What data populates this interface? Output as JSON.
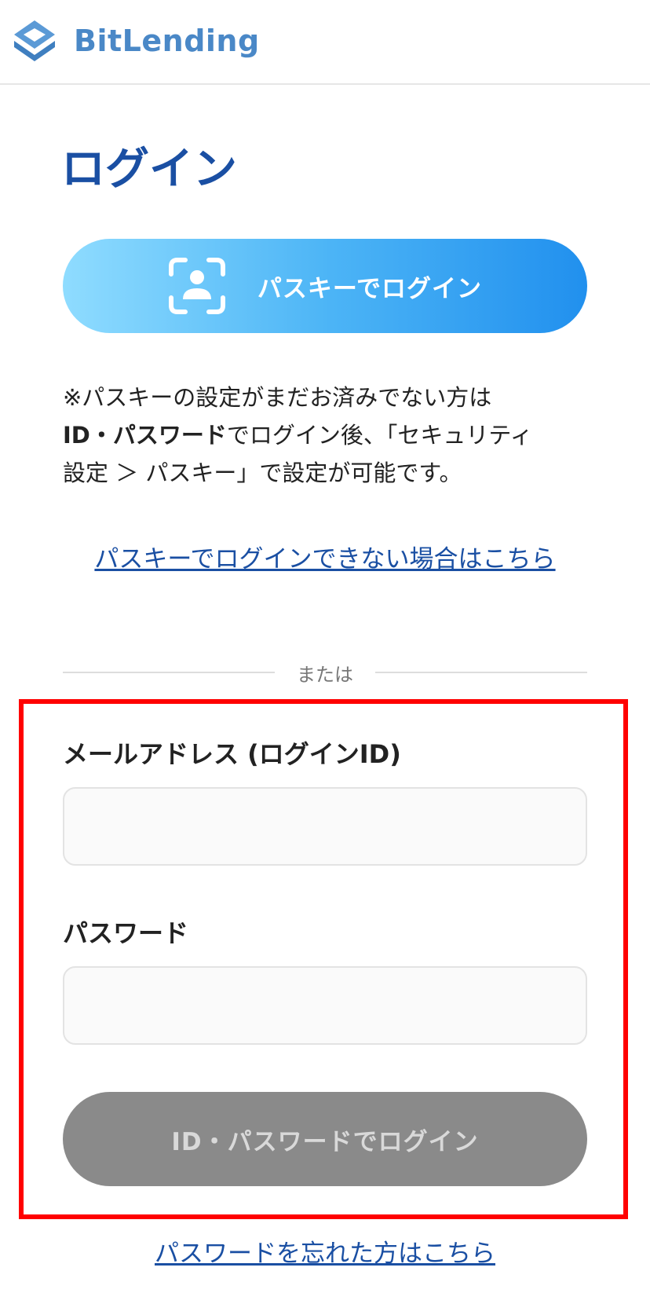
{
  "header": {
    "logo_text": "BitLending",
    "logo_icon": "bitlending-logo-icon"
  },
  "page": {
    "title": "ログイン"
  },
  "passkey": {
    "button_label": "パスキーでログイン",
    "icon": "face-scan-icon",
    "note_line1": "※パスキーの設定がまだお済みでない方は",
    "note_bold": "ID・パスワード",
    "note_line2_rest": "でログイン後、「セキュリティ",
    "note_line3": "設定 ＞ パスキー」で設定が可能です。",
    "help_link": "パスキーでログインできない場合はこちら"
  },
  "divider": {
    "text": "または"
  },
  "form": {
    "email_label": "メールアドレス (ログインID)",
    "email_value": "",
    "password_label": "パスワード",
    "password_value": "",
    "submit_label": "ID・パスワードでログイン",
    "forgot_link": "パスワードを忘れた方はこちら"
  },
  "colors": {
    "brand_blue": "#1a4fa3",
    "logo_blue": "#4a88c7",
    "passkey_gradient_start": "#8fdcff",
    "passkey_gradient_end": "#2190ee",
    "disabled_button": "#8a8a8a",
    "highlight_red": "#ff0000"
  }
}
